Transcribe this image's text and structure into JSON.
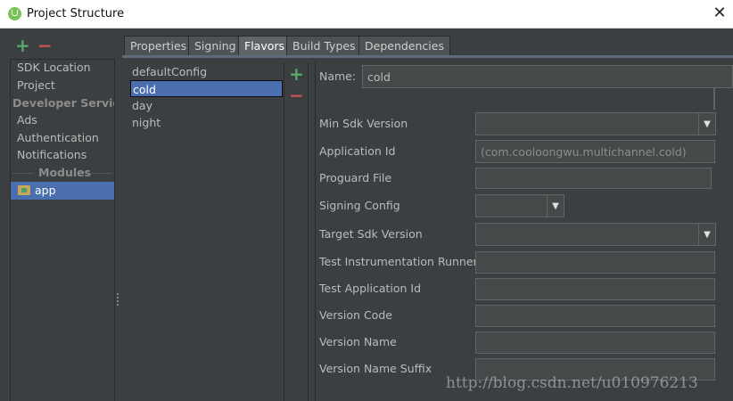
{
  "window": {
    "title": "Project Structure",
    "close_glyph": "✕"
  },
  "sidebar": {
    "add_glyph": "+",
    "remove_glyph": "−",
    "items": [
      "SDK Location",
      "Project"
    ],
    "developer_services_header": "Developer Servic...",
    "developer_services": [
      "Ads",
      "Authentication",
      "Notifications"
    ],
    "modules_header": "Modules",
    "modules": [
      "app"
    ]
  },
  "tabs": [
    "Properties",
    "Signing",
    "Flavors",
    "Build Types",
    "Dependencies"
  ],
  "active_tab": "Flavors",
  "flavors": {
    "items": [
      "defaultConfig",
      "cold",
      "day",
      "night"
    ],
    "selected": "cold",
    "add_glyph": "+",
    "remove_glyph": "−"
  },
  "form": {
    "name_label": "Name:",
    "name_value": "cold",
    "min_sdk_label": "Min Sdk Version",
    "application_id_label": "Application Id",
    "application_id_placeholder": "(com.cooloongwu.multichannel.cold)",
    "proguard_label": "Proguard File",
    "signing_config_label": "Signing Config",
    "target_sdk_label": "Target Sdk Version",
    "test_runner_label": "Test Instrumentation Runner",
    "test_app_id_label": "Test Application Id",
    "version_code_label": "Version Code",
    "version_name_label": "Version Name",
    "version_name_suffix_label": "Version Name Suffix",
    "dropdown_glyph": "▼"
  },
  "watermark": "http://blog.csdn.net/u010976213",
  "colors": {
    "selection": "#4b6eaf",
    "add": "#59a869",
    "remove": "#c75450",
    "background": "#3c3f41"
  }
}
